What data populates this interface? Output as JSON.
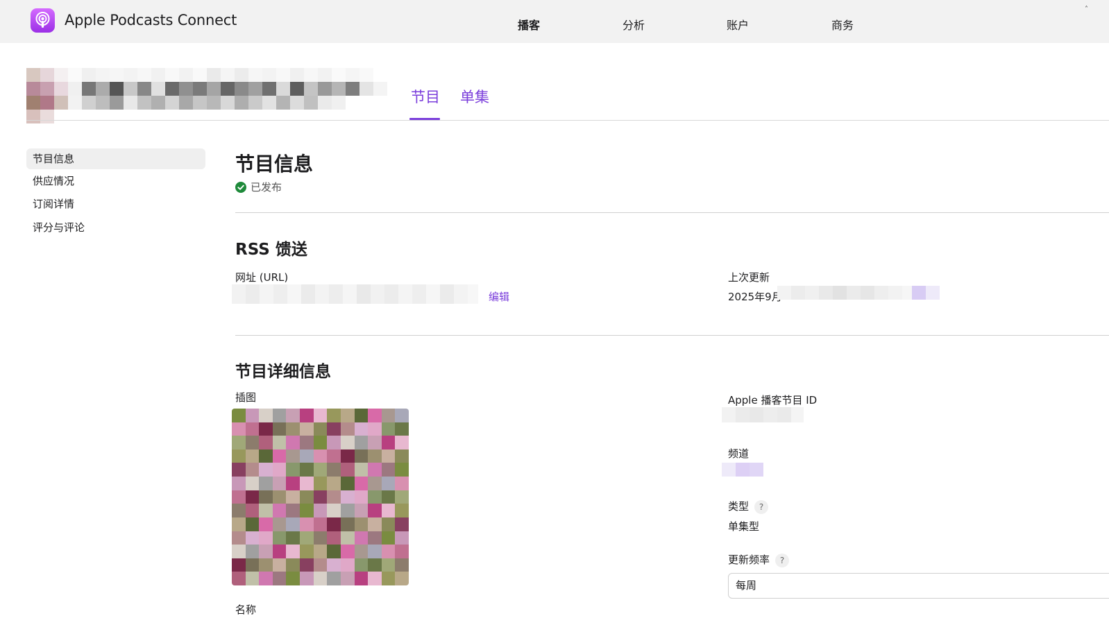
{
  "app": {
    "title": "Apple Podcasts Connect",
    "icon": "podcasts-icon",
    "accent_color": "#7a3ddb"
  },
  "nav": {
    "items": [
      {
        "label": "播客",
        "active": true
      },
      {
        "label": "分析",
        "active": false
      },
      {
        "label": "账户",
        "active": false
      },
      {
        "label": "商务",
        "active": false
      }
    ]
  },
  "tabs": [
    {
      "label": "节目",
      "active": true
    },
    {
      "label": "单集",
      "active": false
    }
  ],
  "sidebar": {
    "items": [
      {
        "label": "节目信息",
        "active": true
      },
      {
        "label": "供应情况",
        "active": false
      },
      {
        "label": "订阅详情",
        "active": false
      },
      {
        "label": "评分与评论",
        "active": false
      }
    ]
  },
  "main": {
    "title": "节目信息",
    "status": {
      "label": "已发布",
      "icon": "checkmark-circle-icon",
      "color": "#1e8a3a"
    },
    "rss": {
      "heading": "RSS 馈送",
      "url_label": "网址 (URL)",
      "edit_label": "编辑",
      "last_updated_label": "上次更新",
      "last_updated_value": "2025年9月"
    },
    "details": {
      "heading": "节目详细信息",
      "artwork_label": "插图",
      "name_label": "名称",
      "podcast_id_label": "Apple 播客节目 ID",
      "channel_label": "频道",
      "type_label": "类型",
      "type_value": "单集型",
      "frequency_label": "更新频率",
      "frequency_value": "每周",
      "help_glyph": "?"
    }
  }
}
